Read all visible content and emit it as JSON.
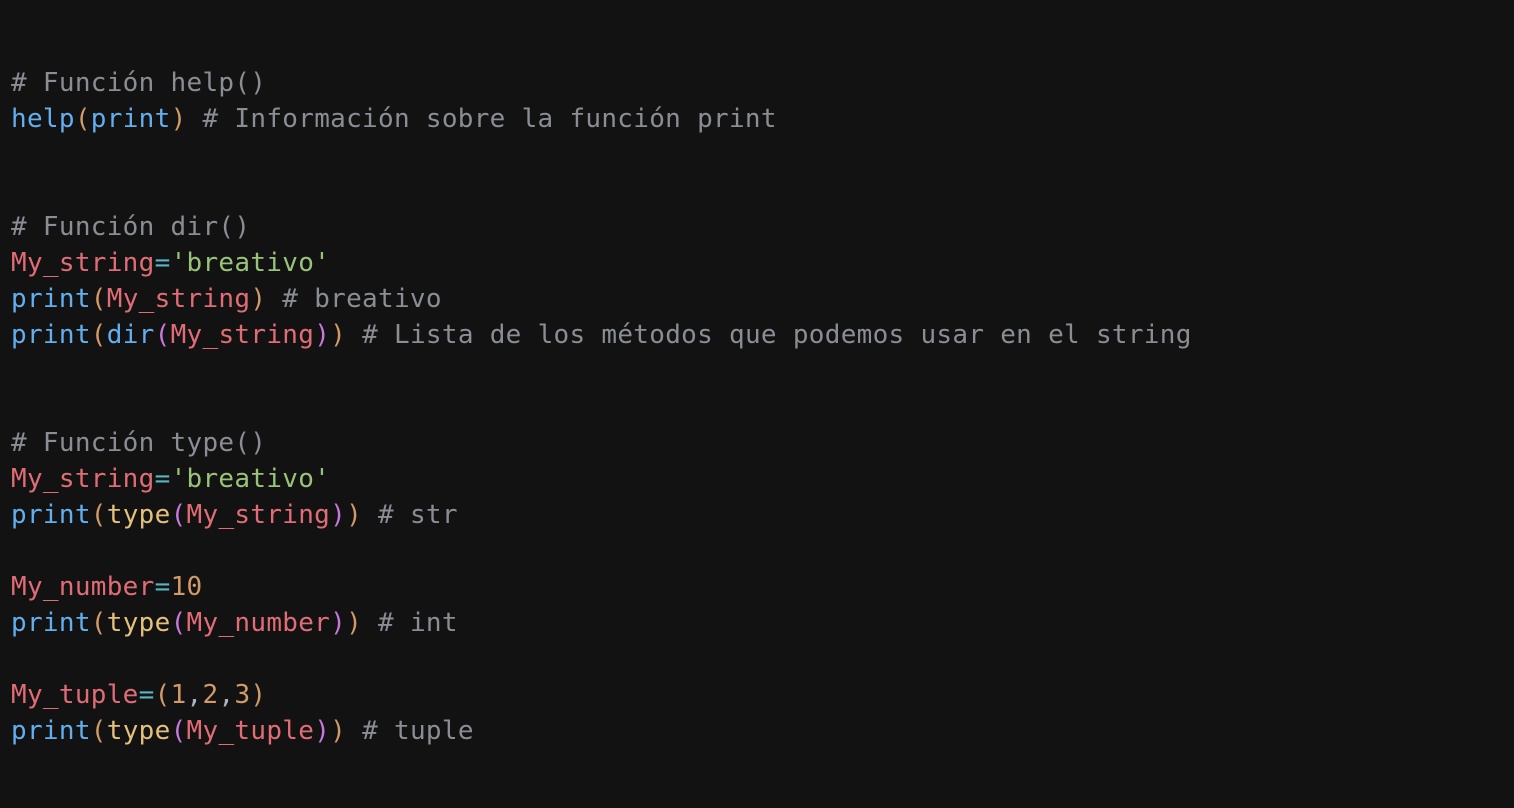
{
  "editor": {
    "theme": {
      "background": "#121212",
      "comment": "#8a8d93",
      "function": "#62aeef",
      "builtin": "#e5c07b",
      "variable": "#e06c75",
      "operator": "#56b6c2",
      "string": "#98c379",
      "number": "#d19a66",
      "paren_level1": "#d19a66",
      "paren_level2": "#c678dd"
    },
    "lines": [
      {
        "tokens": [
          {
            "t": "comment",
            "v": "# Función help()"
          }
        ]
      },
      {
        "tokens": [
          {
            "t": "func",
            "v": "help"
          },
          {
            "t": "paren1",
            "v": "("
          },
          {
            "t": "func",
            "v": "print"
          },
          {
            "t": "paren1",
            "v": ")"
          },
          {
            "t": "space",
            "v": " "
          },
          {
            "t": "comment",
            "v": "# Información sobre la función print"
          }
        ]
      },
      {
        "tokens": []
      },
      {
        "tokens": []
      },
      {
        "tokens": [
          {
            "t": "comment",
            "v": "# Función dir()"
          }
        ]
      },
      {
        "tokens": [
          {
            "t": "var",
            "v": "My_string"
          },
          {
            "t": "op",
            "v": "="
          },
          {
            "t": "string",
            "v": "'breativo'"
          }
        ]
      },
      {
        "tokens": [
          {
            "t": "func",
            "v": "print"
          },
          {
            "t": "paren1",
            "v": "("
          },
          {
            "t": "var",
            "v": "My_string"
          },
          {
            "t": "paren1",
            "v": ")"
          },
          {
            "t": "space",
            "v": " "
          },
          {
            "t": "comment",
            "v": "# breativo"
          }
        ]
      },
      {
        "tokens": [
          {
            "t": "func",
            "v": "print"
          },
          {
            "t": "paren1",
            "v": "("
          },
          {
            "t": "func",
            "v": "dir"
          },
          {
            "t": "paren2",
            "v": "("
          },
          {
            "t": "var",
            "v": "My_string"
          },
          {
            "t": "paren2",
            "v": ")"
          },
          {
            "t": "paren1",
            "v": ")"
          },
          {
            "t": "space",
            "v": " "
          },
          {
            "t": "comment",
            "v": "# Lista de los métodos que podemos usar en el string"
          }
        ]
      },
      {
        "tokens": []
      },
      {
        "tokens": []
      },
      {
        "tokens": [
          {
            "t": "comment",
            "v": "# Función type()"
          }
        ]
      },
      {
        "tokens": [
          {
            "t": "var",
            "v": "My_string"
          },
          {
            "t": "op",
            "v": "="
          },
          {
            "t": "string",
            "v": "'breativo'"
          }
        ]
      },
      {
        "tokens": [
          {
            "t": "func",
            "v": "print"
          },
          {
            "t": "paren1",
            "v": "("
          },
          {
            "t": "builtin",
            "v": "type"
          },
          {
            "t": "paren2",
            "v": "("
          },
          {
            "t": "var",
            "v": "My_string"
          },
          {
            "t": "paren2",
            "v": ")"
          },
          {
            "t": "paren1",
            "v": ")"
          },
          {
            "t": "space",
            "v": " "
          },
          {
            "t": "comment",
            "v": "# str"
          }
        ]
      },
      {
        "tokens": []
      },
      {
        "tokens": [
          {
            "t": "var",
            "v": "My_number"
          },
          {
            "t": "op",
            "v": "="
          },
          {
            "t": "number",
            "v": "10"
          }
        ]
      },
      {
        "tokens": [
          {
            "t": "func",
            "v": "print"
          },
          {
            "t": "paren1",
            "v": "("
          },
          {
            "t": "builtin",
            "v": "type"
          },
          {
            "t": "paren2",
            "v": "("
          },
          {
            "t": "var",
            "v": "My_number"
          },
          {
            "t": "paren2",
            "v": ")"
          },
          {
            "t": "paren1",
            "v": ")"
          },
          {
            "t": "space",
            "v": " "
          },
          {
            "t": "comment",
            "v": "# int"
          }
        ]
      },
      {
        "tokens": []
      },
      {
        "tokens": [
          {
            "t": "var",
            "v": "My_tuple"
          },
          {
            "t": "op",
            "v": "="
          },
          {
            "t": "paren1",
            "v": "("
          },
          {
            "t": "number",
            "v": "1"
          },
          {
            "t": "punct",
            "v": ","
          },
          {
            "t": "number",
            "v": "2"
          },
          {
            "t": "punct",
            "v": ","
          },
          {
            "t": "number",
            "v": "3"
          },
          {
            "t": "paren1",
            "v": ")"
          }
        ]
      },
      {
        "tokens": [
          {
            "t": "func",
            "v": "print"
          },
          {
            "t": "paren1",
            "v": "("
          },
          {
            "t": "builtin",
            "v": "type"
          },
          {
            "t": "paren2",
            "v": "("
          },
          {
            "t": "var",
            "v": "My_tuple"
          },
          {
            "t": "paren2",
            "v": ")"
          },
          {
            "t": "paren1",
            "v": ")"
          },
          {
            "t": "space",
            "v": " "
          },
          {
            "t": "comment",
            "v": "# tuple"
          }
        ]
      }
    ]
  }
}
